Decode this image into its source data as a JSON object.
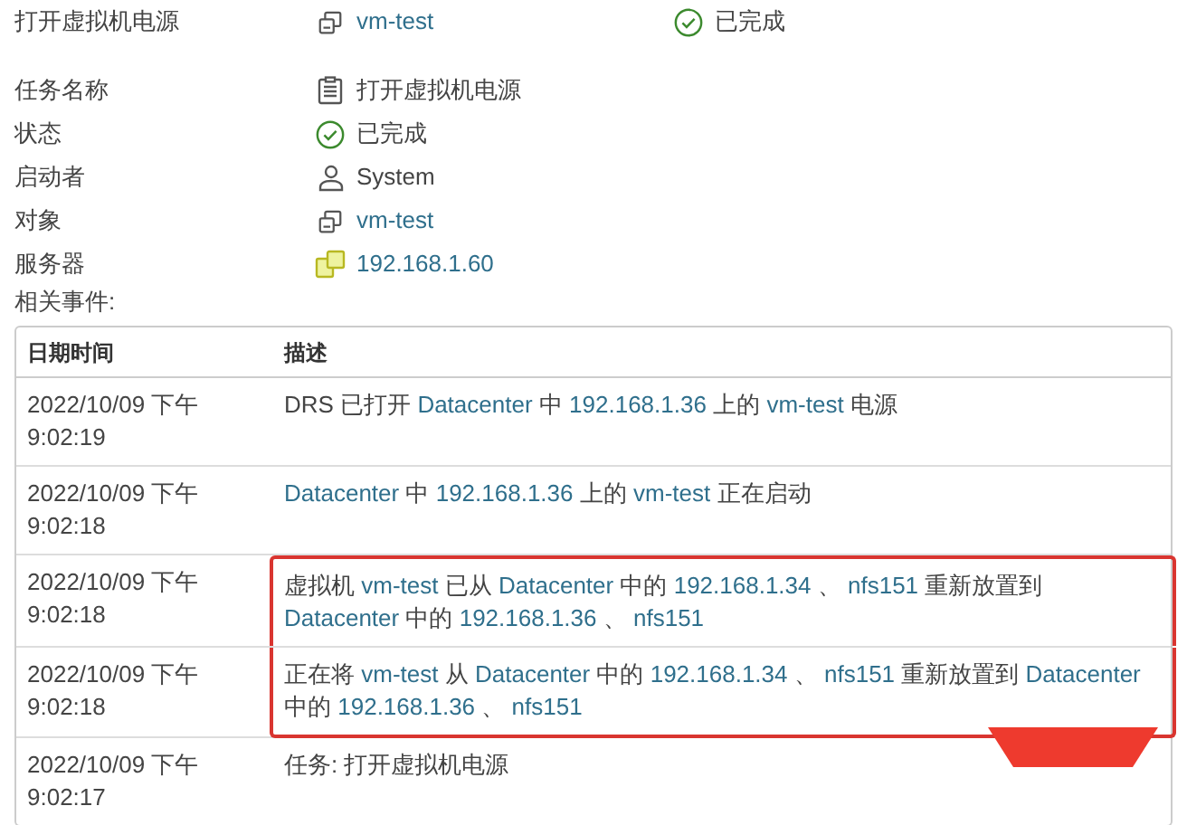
{
  "header": {
    "title": "打开虚拟机电源",
    "object": {
      "kind": "vm",
      "text": "vm-test"
    },
    "status": {
      "kind": "success",
      "text": "已完成"
    }
  },
  "details": [
    {
      "label": "任务名称",
      "kind": "task",
      "value": "打开虚拟机电源",
      "link": false
    },
    {
      "label": "状态",
      "kind": "success",
      "value": "已完成",
      "link": false
    },
    {
      "label": "启动者",
      "kind": "user",
      "value": "System",
      "link": false
    },
    {
      "label": "对象",
      "kind": "vm",
      "value": "vm-test",
      "link": true
    },
    {
      "label": "服务器",
      "kind": "host",
      "value": "192.168.1.60",
      "link": true
    }
  ],
  "events": {
    "label": "相关事件:",
    "columns": [
      "日期时间",
      "描述"
    ],
    "rows": [
      {
        "date": "2022/10/09 下午 9:02:19",
        "highlighted": false,
        "description": [
          {
            "text": "DRS 已打开",
            "link": false
          },
          {
            "text": "Datacenter",
            "link": true
          },
          {
            "text": "中",
            "link": false
          },
          {
            "text": "192.168.1.36",
            "link": true
          },
          {
            "text": "上的",
            "link": false
          },
          {
            "text": "vm-test",
            "link": true
          },
          {
            "text": "电源",
            "link": false
          }
        ]
      },
      {
        "date": "2022/10/09 下午 9:02:18",
        "highlighted": false,
        "description": [
          {
            "text": "Datacenter",
            "link": true
          },
          {
            "text": "中",
            "link": false
          },
          {
            "text": "192.168.1.36",
            "link": true
          },
          {
            "text": "上的",
            "link": false
          },
          {
            "text": "vm-test",
            "link": true
          },
          {
            "text": "正在启动",
            "link": false
          }
        ]
      },
      {
        "date": "2022/10/09 下午 9:02:18",
        "highlighted": true,
        "description": [
          {
            "text": "虚拟机",
            "link": false
          },
          {
            "text": "vm-test",
            "link": true
          },
          {
            "text": "已从",
            "link": false
          },
          {
            "text": "Datacenter",
            "link": true
          },
          {
            "text": "中的",
            "link": false
          },
          {
            "text": "192.168.1.34",
            "link": true
          },
          {
            "text": "、",
            "link": false
          },
          {
            "text": "nfs151",
            "link": true
          },
          {
            "text": "重新放置到",
            "link": false
          },
          {
            "text": "Datacenter",
            "link": true
          },
          {
            "text": "中的",
            "link": false
          },
          {
            "text": "192.168.1.36",
            "link": true
          },
          {
            "text": "、",
            "link": false
          },
          {
            "text": "nfs151",
            "link": true
          }
        ]
      },
      {
        "date": "2022/10/09 下午 9:02:18",
        "highlighted": true,
        "description": [
          {
            "text": "正在将",
            "link": false
          },
          {
            "text": "vm-test",
            "link": true
          },
          {
            "text": "从",
            "link": false
          },
          {
            "text": "Datacenter",
            "link": true
          },
          {
            "text": "中的",
            "link": false
          },
          {
            "text": "192.168.1.34",
            "link": true
          },
          {
            "text": "、",
            "link": false
          },
          {
            "text": "nfs151",
            "link": true
          },
          {
            "text": "重新放置到",
            "link": false
          },
          {
            "text": "Datacenter",
            "link": true
          },
          {
            "text": "中的",
            "link": false
          },
          {
            "text": "192.168.1.36",
            "link": true
          },
          {
            "text": "、",
            "link": false
          },
          {
            "text": "nfs151",
            "link": true
          }
        ]
      },
      {
        "date": "2022/10/09 下午 9:02:17",
        "highlighted": false,
        "description": [
          {
            "text": "任务: 打开虚拟机电源",
            "link": false
          }
        ]
      }
    ]
  }
}
